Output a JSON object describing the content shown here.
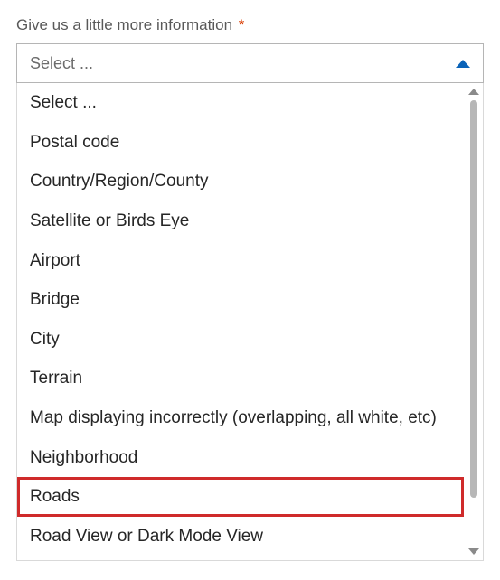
{
  "field": {
    "label": "Give us a little more information",
    "required_mark": "*"
  },
  "select": {
    "value": "Select ..."
  },
  "options": [
    {
      "label": "Select ...",
      "highlighted": false
    },
    {
      "label": "Postal code",
      "highlighted": false
    },
    {
      "label": "Country/Region/County",
      "highlighted": false
    },
    {
      "label": "Satellite or Birds Eye",
      "highlighted": false
    },
    {
      "label": "Airport",
      "highlighted": false
    },
    {
      "label": "Bridge",
      "highlighted": false
    },
    {
      "label": "City",
      "highlighted": false
    },
    {
      "label": "Terrain",
      "highlighted": false
    },
    {
      "label": "Map displaying incorrectly (overlapping, all white, etc)",
      "highlighted": false
    },
    {
      "label": "Neighborhood",
      "highlighted": false
    },
    {
      "label": "Roads",
      "highlighted": true
    },
    {
      "label": "Road View or Dark Mode View",
      "highlighted": false
    }
  ]
}
